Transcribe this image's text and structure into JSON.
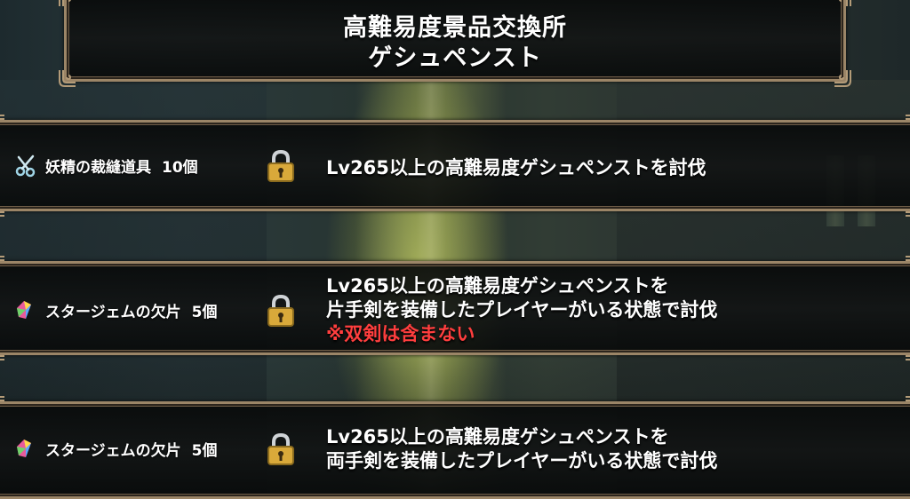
{
  "header": {
    "title_line1": "高難易度景品交換所",
    "title_line2": "ゲシュペンスト"
  },
  "rewards": [
    {
      "item_name": "妖精の裁縫道具",
      "quantity": "10個",
      "icon": "scissors-icon",
      "locked": true,
      "condition_line1": "Lv265以上の高難易度ゲシュペンストを討伐"
    },
    {
      "item_name": "スタージェムの欠片",
      "quantity": "5個",
      "icon": "star-gem-fragment-icon",
      "locked": true,
      "condition_line1": "Lv265以上の高難易度ゲシュペンストを",
      "condition_line2": "片手剣を装備したプレイヤーがいる状態で討伐",
      "condition_note": "※双剣は含まない"
    },
    {
      "item_name": "スタージェムの欠片",
      "quantity": "5個",
      "icon": "star-gem-fragment-icon",
      "locked": true,
      "condition_line1": "Lv265以上の高難易度ゲシュペンストを",
      "condition_line2": "両手剣を装備したプレイヤーがいる状態で討伐"
    }
  ],
  "colors": {
    "frame": "#9b8567",
    "text": "#ffffff",
    "warning": "#ff3e3e",
    "lock_gold": "#d9a93a"
  }
}
